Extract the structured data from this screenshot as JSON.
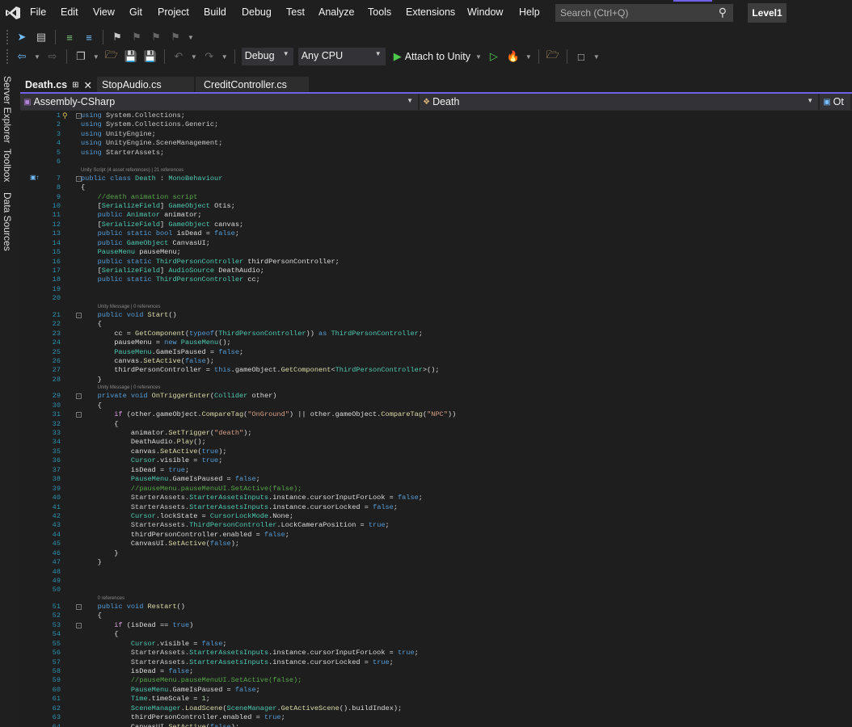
{
  "menu": [
    "File",
    "Edit",
    "View",
    "Git",
    "Project",
    "Build",
    "Debug",
    "Test",
    "Analyze",
    "Tools",
    "Extensions",
    "Window",
    "Help"
  ],
  "search": {
    "placeholder": "Search (Ctrl+Q)"
  },
  "solution": "Level1",
  "toolbar": {
    "config": "Debug",
    "platform": "Any CPU",
    "run_label": "Attach to Unity"
  },
  "side_tabs": [
    "Server Explorer",
    "Toolbox",
    "Data Sources"
  ],
  "tabs": [
    {
      "label": "Death.cs",
      "active": true
    },
    {
      "label": "StopAudio.cs"
    },
    {
      "label": "CreditController.cs"
    }
  ],
  "nav": {
    "project": "Assembly-CSharp",
    "type": "Death",
    "member": "Ot"
  },
  "accent": "#7160e8",
  "code": {
    "lines": [
      {
        "n": "1",
        "fold": true,
        "tokens": [
          [
            "k",
            "using"
          ],
          [
            "ns",
            " System.Collections;"
          ]
        ]
      },
      {
        "n": "2",
        "tokens": [
          [
            "k",
            "using"
          ],
          [
            "ns",
            " System.Collections.Generic;"
          ]
        ]
      },
      {
        "n": "3",
        "tokens": [
          [
            "k",
            "using"
          ],
          [
            "ns",
            " UnityEngine;"
          ]
        ]
      },
      {
        "n": "4",
        "tokens": [
          [
            "k",
            "using"
          ],
          [
            "ns",
            " UnityEngine.SceneManagement;"
          ]
        ]
      },
      {
        "n": "5",
        "tokens": [
          [
            "k",
            "using"
          ],
          [
            "ns",
            " StarterAssets;"
          ]
        ]
      },
      {
        "n": "6",
        "tokens": []
      },
      {
        "n": "7",
        "fold": true,
        "lens": "Unity Script (4 asset references) | 21 references",
        "tokens": [
          [
            "k",
            "public class "
          ],
          [
            "t",
            "Death"
          ],
          [
            "p",
            " : "
          ],
          [
            "t",
            "MonoBehaviour"
          ]
        ]
      },
      {
        "n": "8",
        "tokens": [
          [
            "p",
            "{"
          ]
        ]
      },
      {
        "n": "9",
        "tokens": [
          [
            "c",
            "    //death animation script"
          ]
        ]
      },
      {
        "n": "10",
        "tokens": [
          [
            "p",
            "    ["
          ],
          [
            "t",
            "SerializeField"
          ],
          [
            "p",
            "] "
          ],
          [
            "t",
            "GameObject"
          ],
          [
            "p",
            " Otis;"
          ]
        ]
      },
      {
        "n": "11",
        "tokens": [
          [
            "k",
            "    public "
          ],
          [
            "t",
            "Animator"
          ],
          [
            "p",
            " animator;"
          ]
        ]
      },
      {
        "n": "12",
        "tokens": [
          [
            "p",
            "    ["
          ],
          [
            "t",
            "SerializeField"
          ],
          [
            "p",
            "] "
          ],
          [
            "t",
            "GameObject"
          ],
          [
            "p",
            " canvas;"
          ]
        ]
      },
      {
        "n": "13",
        "tokens": [
          [
            "k",
            "    public static bool"
          ],
          [
            "p",
            " isDead = "
          ],
          [
            "k",
            "false"
          ],
          [
            "p",
            ";"
          ]
        ]
      },
      {
        "n": "14",
        "tokens": [
          [
            "k",
            "    public "
          ],
          [
            "t",
            "GameObject"
          ],
          [
            "p",
            " CanvasUI;"
          ]
        ]
      },
      {
        "n": "15",
        "tokens": [
          [
            "t",
            "    PauseMenu"
          ],
          [
            "p",
            " pauseMenu;"
          ]
        ]
      },
      {
        "n": "16",
        "tokens": [
          [
            "k",
            "    public static "
          ],
          [
            "t",
            "ThirdPersonController"
          ],
          [
            "p",
            " thirdPersonController;"
          ]
        ]
      },
      {
        "n": "17",
        "tokens": [
          [
            "p",
            "    ["
          ],
          [
            "t",
            "SerializeField"
          ],
          [
            "p",
            "] "
          ],
          [
            "t",
            "AudioSource"
          ],
          [
            "p",
            " DeathAudio;"
          ]
        ]
      },
      {
        "n": "18",
        "tokens": [
          [
            "k",
            "    public static "
          ],
          [
            "t",
            "ThirdPersonController"
          ],
          [
            "p",
            " cc;"
          ]
        ]
      },
      {
        "n": "19",
        "tokens": []
      },
      {
        "n": "20",
        "tokens": []
      },
      {
        "n": "21",
        "fold": true,
        "lens": "Unity Message | 0 references",
        "tokens": [
          [
            "k",
            "    public void "
          ],
          [
            "m",
            "Start"
          ],
          [
            "p",
            "()"
          ]
        ]
      },
      {
        "n": "22",
        "tokens": [
          [
            "p",
            "    {"
          ]
        ]
      },
      {
        "n": "23",
        "tokens": [
          [
            "p",
            "        cc = "
          ],
          [
            "m",
            "GetComponent"
          ],
          [
            "p",
            "("
          ],
          [
            "k",
            "typeof"
          ],
          [
            "p",
            "("
          ],
          [
            "t",
            "ThirdPersonController"
          ],
          [
            "p",
            ")) "
          ],
          [
            "k",
            "as "
          ],
          [
            "t",
            "ThirdPersonController"
          ],
          [
            "p",
            ";"
          ]
        ]
      },
      {
        "n": "24",
        "tokens": [
          [
            "p",
            "        pauseMenu = "
          ],
          [
            "k",
            "new "
          ],
          [
            "t",
            "PauseMenu"
          ],
          [
            "p",
            "();"
          ]
        ]
      },
      {
        "n": "25",
        "tokens": [
          [
            "t",
            "        PauseMenu"
          ],
          [
            "p",
            ".GameIsPaused = "
          ],
          [
            "k",
            "false"
          ],
          [
            "p",
            ";"
          ]
        ]
      },
      {
        "n": "26",
        "tokens": [
          [
            "p",
            "        canvas."
          ],
          [
            "m",
            "SetActive"
          ],
          [
            "p",
            "("
          ],
          [
            "k",
            "false"
          ],
          [
            "p",
            ");"
          ]
        ]
      },
      {
        "n": "27",
        "tokens": [
          [
            "p",
            "        thirdPersonController = "
          ],
          [
            "k",
            "this"
          ],
          [
            "p",
            ".gameObject."
          ],
          [
            "m",
            "GetComponent"
          ],
          [
            "p",
            "<"
          ],
          [
            "t",
            "ThirdPersonController"
          ],
          [
            "p",
            ">();"
          ]
        ]
      },
      {
        "n": "28",
        "tokens": [
          [
            "p",
            "    }"
          ]
        ]
      },
      {
        "n": "29",
        "fold": true,
        "lens": "Unity Message | 0 references",
        "tokens": [
          [
            "k",
            "    private void "
          ],
          [
            "m",
            "OnTriggerEnter"
          ],
          [
            "p",
            "("
          ],
          [
            "t",
            "Collider"
          ],
          [
            "p",
            " other)"
          ]
        ]
      },
      {
        "n": "30",
        "tokens": [
          [
            "p",
            "    {"
          ]
        ]
      },
      {
        "n": "31",
        "fold": true,
        "tokens": [
          [
            "f",
            "        if"
          ],
          [
            "p",
            " (other.gameObject."
          ],
          [
            "m",
            "CompareTag"
          ],
          [
            "p",
            "("
          ],
          [
            "s",
            "\"OnGround\""
          ],
          [
            "p",
            ") || other.gameObject."
          ],
          [
            "m",
            "CompareTag"
          ],
          [
            "p",
            "("
          ],
          [
            "s",
            "\"NPC\""
          ],
          [
            "p",
            "))"
          ]
        ]
      },
      {
        "n": "32",
        "tokens": [
          [
            "p",
            "        {"
          ]
        ]
      },
      {
        "n": "33",
        "tokens": [
          [
            "p",
            "            animator."
          ],
          [
            "m",
            "SetTrigger"
          ],
          [
            "p",
            "("
          ],
          [
            "s",
            "\"death\""
          ],
          [
            "p",
            ");"
          ]
        ]
      },
      {
        "n": "34",
        "tokens": [
          [
            "p",
            "            DeathAudio."
          ],
          [
            "m",
            "Play"
          ],
          [
            "p",
            "();"
          ]
        ]
      },
      {
        "n": "35",
        "tokens": [
          [
            "p",
            "            canvas."
          ],
          [
            "m",
            "SetActive"
          ],
          [
            "p",
            "("
          ],
          [
            "k",
            "true"
          ],
          [
            "p",
            ");"
          ]
        ]
      },
      {
        "n": "36",
        "tokens": [
          [
            "t",
            "            Cursor"
          ],
          [
            "p",
            ".visible = "
          ],
          [
            "k",
            "true"
          ],
          [
            "p",
            ";"
          ]
        ]
      },
      {
        "n": "37",
        "tokens": [
          [
            "p",
            "            isDead = "
          ],
          [
            "k",
            "true"
          ],
          [
            "p",
            ";"
          ]
        ]
      },
      {
        "n": "38",
        "tokens": [
          [
            "t",
            "            PauseMenu"
          ],
          [
            "p",
            ".GameIsPaused = "
          ],
          [
            "k",
            "false"
          ],
          [
            "p",
            ";"
          ]
        ]
      },
      {
        "n": "39",
        "tokens": [
          [
            "c",
            "            //pauseMenu.pauseMenuUI.SetActive(false);"
          ]
        ]
      },
      {
        "n": "40",
        "tokens": [
          [
            "ns",
            "            StarterAssets."
          ],
          [
            "t",
            "StarterAssetsInputs"
          ],
          [
            "p",
            ".instance.cursorInputForLook = "
          ],
          [
            "k",
            "false"
          ],
          [
            "p",
            ";"
          ]
        ]
      },
      {
        "n": "41",
        "tokens": [
          [
            "ns",
            "            StarterAssets."
          ],
          [
            "t",
            "StarterAssetsInputs"
          ],
          [
            "p",
            ".instance.cursorLocked = "
          ],
          [
            "k",
            "false"
          ],
          [
            "p",
            ";"
          ]
        ]
      },
      {
        "n": "42",
        "tokens": [
          [
            "t",
            "            Cursor"
          ],
          [
            "p",
            ".lockState = "
          ],
          [
            "t",
            "CursorLockMode"
          ],
          [
            "p",
            ".None;"
          ]
        ]
      },
      {
        "n": "43",
        "tokens": [
          [
            "ns",
            "            StarterAssets."
          ],
          [
            "t",
            "ThirdPersonController"
          ],
          [
            "p",
            ".LockCameraPosition = "
          ],
          [
            "k",
            "true"
          ],
          [
            "p",
            ";"
          ]
        ]
      },
      {
        "n": "44",
        "tokens": [
          [
            "p",
            "            thirdPersonController.enabled = "
          ],
          [
            "k",
            "false"
          ],
          [
            "p",
            ";"
          ]
        ]
      },
      {
        "n": "45",
        "tokens": [
          [
            "p",
            "            CanvasUI."
          ],
          [
            "m",
            "SetActive"
          ],
          [
            "p",
            "("
          ],
          [
            "k",
            "false"
          ],
          [
            "p",
            ");"
          ]
        ]
      },
      {
        "n": "46",
        "tokens": [
          [
            "p",
            "        }"
          ]
        ]
      },
      {
        "n": "47",
        "tokens": [
          [
            "p",
            "    }"
          ]
        ]
      },
      {
        "n": "48",
        "tokens": []
      },
      {
        "n": "49",
        "tokens": []
      },
      {
        "n": "50",
        "tokens": []
      },
      {
        "n": "51",
        "fold": true,
        "lens": "0 references",
        "tokens": [
          [
            "k",
            "    public void "
          ],
          [
            "m",
            "Restart"
          ],
          [
            "p",
            "()"
          ]
        ]
      },
      {
        "n": "52",
        "tokens": [
          [
            "p",
            "    {"
          ]
        ]
      },
      {
        "n": "53",
        "fold": true,
        "tokens": [
          [
            "f",
            "        if"
          ],
          [
            "p",
            " (isDead == "
          ],
          [
            "k",
            "true"
          ],
          [
            "p",
            ")"
          ]
        ]
      },
      {
        "n": "54",
        "tokens": [
          [
            "p",
            "        {"
          ]
        ]
      },
      {
        "n": "55",
        "tokens": [
          [
            "t",
            "            Cursor"
          ],
          [
            "p",
            ".visible = "
          ],
          [
            "k",
            "false"
          ],
          [
            "p",
            ";"
          ]
        ]
      },
      {
        "n": "56",
        "tokens": [
          [
            "ns",
            "            StarterAssets."
          ],
          [
            "t",
            "StarterAssetsInputs"
          ],
          [
            "p",
            ".instance.cursorInputForLook = "
          ],
          [
            "k",
            "true"
          ],
          [
            "p",
            ";"
          ]
        ]
      },
      {
        "n": "57",
        "tokens": [
          [
            "ns",
            "            StarterAssets."
          ],
          [
            "t",
            "StarterAssetsInputs"
          ],
          [
            "p",
            ".instance.cursorLocked = "
          ],
          [
            "k",
            "true"
          ],
          [
            "p",
            ";"
          ]
        ]
      },
      {
        "n": "58",
        "tokens": [
          [
            "p",
            "            isDead = "
          ],
          [
            "k",
            "false"
          ],
          [
            "p",
            ";"
          ]
        ]
      },
      {
        "n": "59",
        "tokens": [
          [
            "c",
            "            //pauseMenu.pauseMenuUI.SetActive(false);"
          ]
        ]
      },
      {
        "n": "60",
        "tokens": [
          [
            "t",
            "            PauseMenu"
          ],
          [
            "p",
            ".GameIsPaused = "
          ],
          [
            "k",
            "false"
          ],
          [
            "p",
            ";"
          ]
        ]
      },
      {
        "n": "61",
        "tokens": [
          [
            "t",
            "            Time"
          ],
          [
            "p",
            ".timeScale = "
          ],
          [
            "n",
            "1"
          ],
          [
            "p",
            ";"
          ]
        ]
      },
      {
        "n": "62",
        "tokens": [
          [
            "t",
            "            SceneManager"
          ],
          [
            "p",
            "."
          ],
          [
            "m",
            "LoadScene"
          ],
          [
            "p",
            "("
          ],
          [
            "t",
            "SceneManager"
          ],
          [
            "p",
            "."
          ],
          [
            "m",
            "GetActiveScene"
          ],
          [
            "p",
            "().buildIndex);"
          ]
        ]
      },
      {
        "n": "63",
        "tokens": [
          [
            "p",
            "            thirdPersonController.enabled = "
          ],
          [
            "k",
            "true"
          ],
          [
            "p",
            ";"
          ]
        ]
      },
      {
        "n": "64",
        "tokens": [
          [
            "p",
            "            CanvasUI."
          ],
          [
            "m",
            "SetActive"
          ],
          [
            "p",
            "("
          ],
          [
            "k",
            "false"
          ],
          [
            "p",
            ");"
          ]
        ]
      }
    ]
  }
}
